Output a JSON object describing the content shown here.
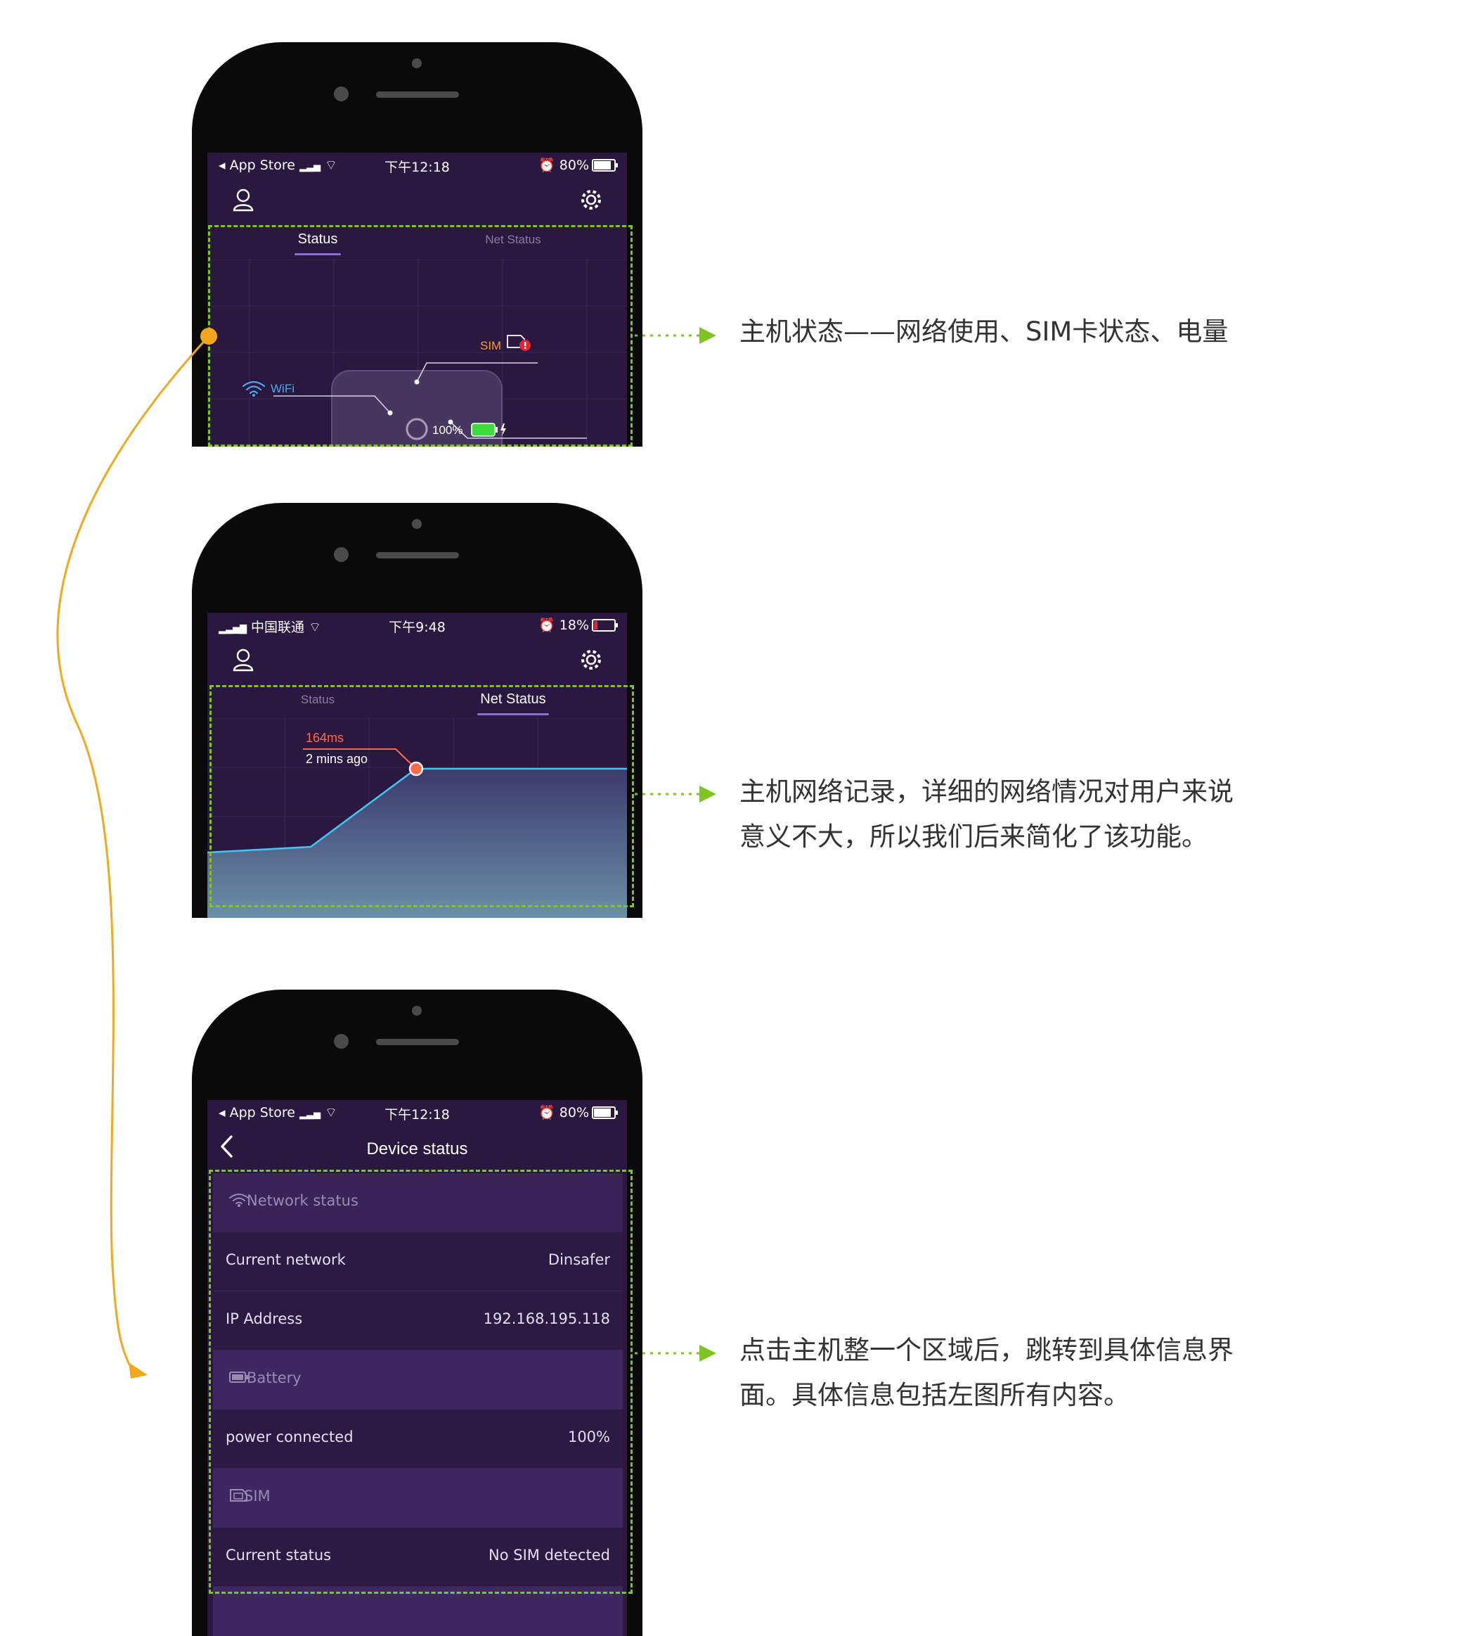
{
  "colors": {
    "background": "#ffffff",
    "phone_frame": "#0a0a0a",
    "screen_bg": "#2b1841",
    "highlight_dash": "#7ec522",
    "connector_line": "#f2a81d",
    "chart_line": "#3ec7f0",
    "latency_label": "#ff6a4a",
    "battery_green": "#3ddc3d",
    "sim_warning": "#e8232e"
  },
  "phone1": {
    "statusbar": {
      "left": "◂ App Store",
      "time": "下午12:18",
      "right": "80%"
    },
    "tabs": [
      {
        "label": "Status",
        "active": true
      },
      {
        "label": "Net Status",
        "active": false
      }
    ],
    "device": {
      "sim_label": "SIM",
      "wifi_label": "WiFi",
      "battery_label": "100%"
    }
  },
  "phone2": {
    "statusbar": {
      "left": "中国联通",
      "time": "下午9:48",
      "right": "18%"
    },
    "tabs": [
      {
        "label": "Status",
        "active": false
      },
      {
        "label": "Net Status",
        "active": true
      }
    ],
    "latency": {
      "value": "164ms",
      "ago": "2 mins ago"
    }
  },
  "phone3": {
    "statusbar": {
      "left": "◂ App Store",
      "time": "下午12:18",
      "right": "80%"
    },
    "nav": {
      "title": "Device status"
    },
    "sections": {
      "network": "Network status",
      "battery": "Battery",
      "sim": "SIM"
    },
    "rows": {
      "current_network": {
        "label": "Current network",
        "value": "Dinsafer"
      },
      "ip": {
        "label": "IP Address",
        "value": "192.168.195.118"
      },
      "power": {
        "label": "power connected",
        "value": "100%"
      },
      "sim_status": {
        "label": "Current status",
        "value": "No SIM detected"
      }
    }
  },
  "callouts": {
    "c1_line1": "主机状态——网络使用、SIM卡状态、电量",
    "c2_line1": "主机网络记录，详细的网络情况对用户来说",
    "c2_line2": "意义不大，所以我们后来简化了该功能。",
    "c3_line1": "点击主机整一个区域后，跳转到具体信息界",
    "c3_line2": "面。具体信息包括左图所有内容。"
  }
}
